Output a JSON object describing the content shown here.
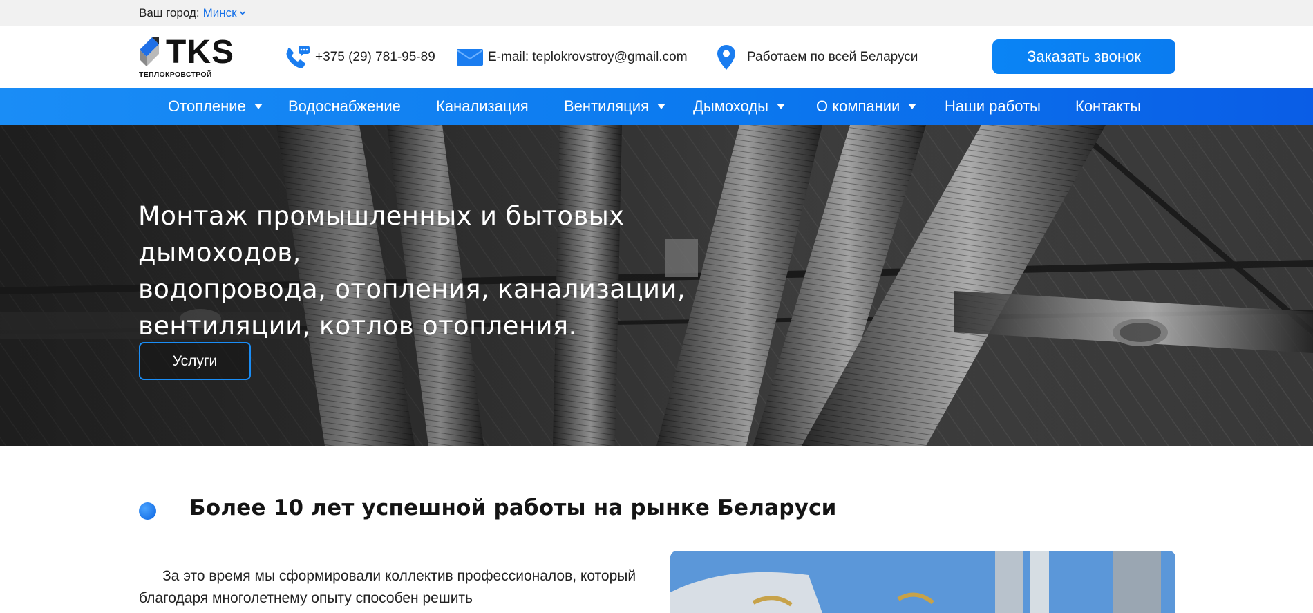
{
  "city_bar": {
    "label": "Ваш город:",
    "city": "Минск"
  },
  "header": {
    "logo": {
      "wordmark": "TKS",
      "tagline": "ТЕПЛОКРОВСТРОЙ"
    },
    "phone": "+375 (29) 781-95-89",
    "email": "E-mail: teplokrovstroy@gmail.com",
    "region": "Работаем по всей Беларуси",
    "callback_button": "Заказать звонок"
  },
  "nav": {
    "items": [
      {
        "label": "Отопление",
        "has_dropdown": true
      },
      {
        "label": "Водоснабжение",
        "has_dropdown": false
      },
      {
        "label": "Канализация",
        "has_dropdown": false
      },
      {
        "label": "Вентиляция",
        "has_dropdown": true
      },
      {
        "label": "Дымоходы",
        "has_dropdown": true
      },
      {
        "label": "О компании",
        "has_dropdown": true
      },
      {
        "label": "Наши работы",
        "has_dropdown": false
      },
      {
        "label": "Контакты",
        "has_dropdown": false
      }
    ]
  },
  "hero": {
    "title_lines": [
      "Монтаж промышленных и бытовых дымоходов,",
      "водопровода, отопления, канализации,",
      "вентиляции, котлов отопления."
    ],
    "button": "Услуги"
  },
  "about": {
    "title": "Более 10 лет успешной работы на рынке Беларуси",
    "text": "За это время мы сформировали коллектив профессионалов, который благодаря многолетнему опыту способен решить"
  },
  "colors": {
    "accent": "#0a84f5",
    "nav_start": "#1a8df6",
    "nav_end": "#0a5de6",
    "city_link": "#1a73e8"
  },
  "icons": {
    "city_dropdown": "chevron-down-icon",
    "phone": "phone-chat-icon",
    "email": "envelope-icon",
    "region": "map-pin-icon",
    "nav_dropdown": "caret-down-icon"
  }
}
